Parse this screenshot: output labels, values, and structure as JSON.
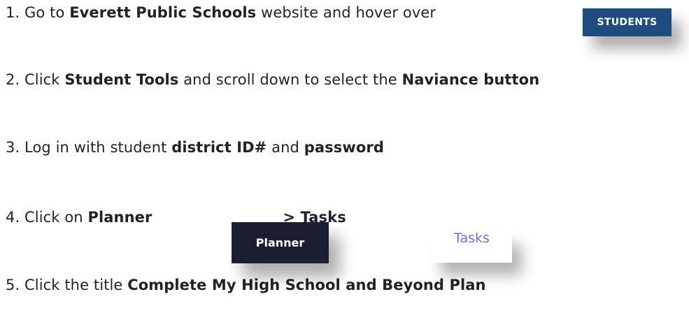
{
  "steps": [
    {
      "number": "1.",
      "parts": [
        "Go to ",
        "Everett Public Schools",
        " website and hover over"
      ]
    },
    {
      "number": "2.",
      "parts": [
        "Click ",
        "Student Tools",
        " and scroll down to select the ",
        "Naviance button"
      ]
    },
    {
      "number": "3.",
      "parts": [
        "Log in with student ",
        "district ID#",
        " and ",
        "password"
      ]
    },
    {
      "number": "4.",
      "parts": [
        "Click on ",
        "Planner",
        "> Tasks"
      ]
    },
    {
      "number": "5.",
      "parts": [
        "Click the title ",
        "Complete My High School and Beyond Plan"
      ]
    }
  ],
  "thumbnails": {
    "students_label": "STUDENTS",
    "planner_label": "Planner",
    "tasks_label": "Tasks"
  },
  "colors": {
    "students_bg": "#1f4c7e",
    "planner_bg": "#1c1e33",
    "tasks_text": "#7b68d6"
  }
}
